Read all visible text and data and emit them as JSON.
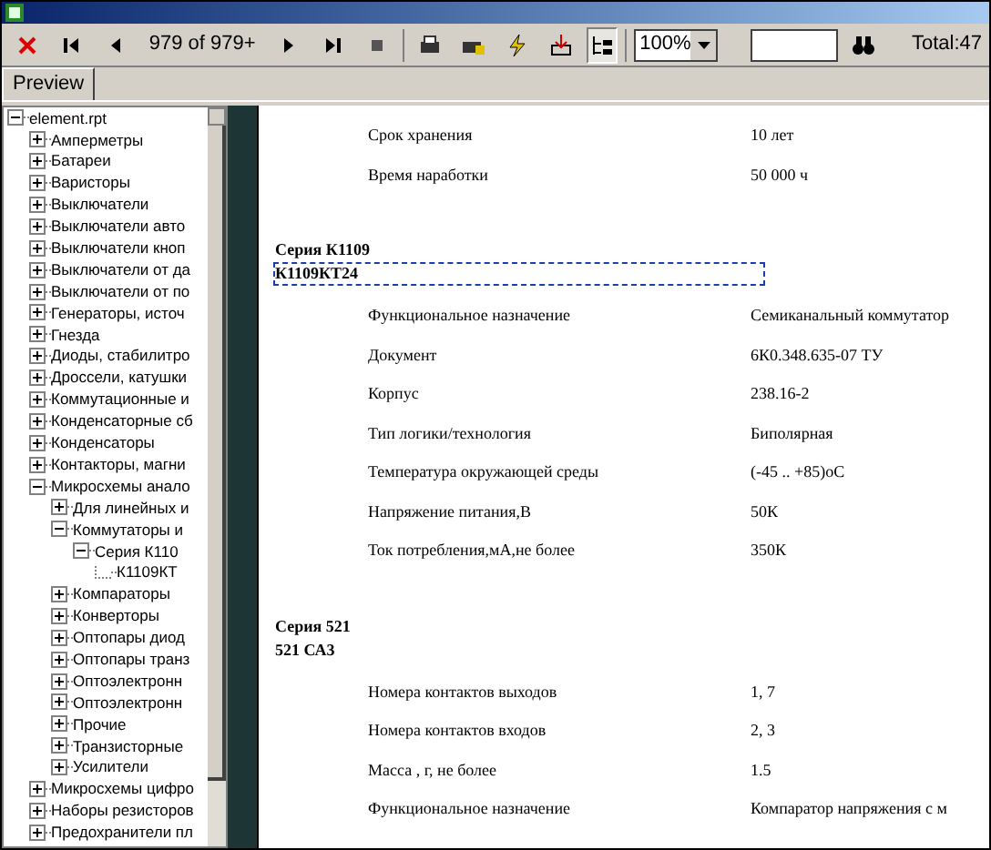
{
  "toolbar": {
    "page_indicator": "979 of 979+",
    "zoom": "100%",
    "outline_toggle": {
      "pressed": true
    },
    "total": "Total:47"
  },
  "tabs": [
    {
      "label": "Preview",
      "selected": true
    }
  ],
  "tree": {
    "label": "element.rpt",
    "expanded": true,
    "children": [
      {
        "label": "Амперметры",
        "expanded": false
      },
      {
        "label": "Батареи",
        "expanded": false
      },
      {
        "label": "Варисторы",
        "expanded": false
      },
      {
        "label": "Выключатели",
        "expanded": false
      },
      {
        "label": "Выключатели авто",
        "expanded": false
      },
      {
        "label": "Выключатели кноп",
        "expanded": false
      },
      {
        "label": "Выключатели от да",
        "expanded": false
      },
      {
        "label": "Выключатели от по",
        "expanded": false
      },
      {
        "label": "Генераторы, источ",
        "expanded": false
      },
      {
        "label": "Гнезда",
        "expanded": false
      },
      {
        "label": "Диоды, стабилитро",
        "expanded": false
      },
      {
        "label": "Дроссели, катушки",
        "expanded": false
      },
      {
        "label": "Коммутационные и",
        "expanded": false
      },
      {
        "label": "Конденсаторные сб",
        "expanded": false
      },
      {
        "label": "Конденсаторы",
        "expanded": false
      },
      {
        "label": "Контакторы, магни",
        "expanded": false
      },
      {
        "label": "Микросхемы анало",
        "expanded": true,
        "children": [
          {
            "label": "Для линейных и",
            "expanded": false
          },
          {
            "label": "Коммутаторы и",
            "expanded": true,
            "children": [
              {
                "label": "Серия К110",
                "expanded": true,
                "children": [
                  {
                    "label": "К1109КТ"
                  }
                ]
              }
            ]
          },
          {
            "label": "Компараторы",
            "expanded": false
          },
          {
            "label": "Конверторы",
            "expanded": false
          },
          {
            "label": "Оптопары диод",
            "expanded": false
          },
          {
            "label": "Оптопары транз",
            "expanded": false
          },
          {
            "label": "Оптоэлектронн",
            "expanded": false
          },
          {
            "label": "Оптоэлектронн",
            "expanded": false
          },
          {
            "label": "Прочие",
            "expanded": false
          },
          {
            "label": "Транзисторные",
            "expanded": false
          },
          {
            "label": "Усилители",
            "expanded": false
          }
        ]
      },
      {
        "label": "Микросхемы цифро",
        "expanded": false
      },
      {
        "label": "Наборы резисторов",
        "expanded": false
      },
      {
        "label": "Предохранители пл",
        "expanded": false
      }
    ]
  },
  "report": [
    {
      "kind": "row",
      "label": "Срок хранения",
      "value": "10 лет"
    },
    {
      "kind": "row",
      "label": "Время наработки",
      "value": "50 000 ч"
    },
    {
      "kind": "heading",
      "lines": [
        "Серия К1109",
        "К1109КТ24"
      ],
      "selected": true
    },
    {
      "kind": "row",
      "label": "Функциональное назначение",
      "value": "Семиканальный коммутатор"
    },
    {
      "kind": "row",
      "label": "Документ",
      "value": "6К0.348.635-07 ТУ"
    },
    {
      "kind": "row",
      "label": "Корпус",
      "value": "238.16-2"
    },
    {
      "kind": "row",
      "label": "Тип логики/технология",
      "value": "Биполярная"
    },
    {
      "kind": "row",
      "label": "Температура окружающей среды",
      "value": "(-45 .. +85)oC"
    },
    {
      "kind": "row",
      "label": "Напряжение питания,В",
      "value": "50К"
    },
    {
      "kind": "row",
      "label": "Ток потребления,мА,не более",
      "value": "350К"
    },
    {
      "kind": "heading",
      "lines": [
        "Серия 521",
        "521 СА3"
      ],
      "selected": false
    },
    {
      "kind": "row",
      "label": "Номера контактов выходов",
      "value": "1, 7"
    },
    {
      "kind": "row",
      "label": "Номера контактов входов",
      "value": "2, 3"
    },
    {
      "kind": "row",
      "label": "Масса , г, не более",
      "value": "1.5"
    },
    {
      "kind": "row",
      "label": "Функциональное назначение",
      "value": "Компаратор напряжения с м"
    }
  ]
}
